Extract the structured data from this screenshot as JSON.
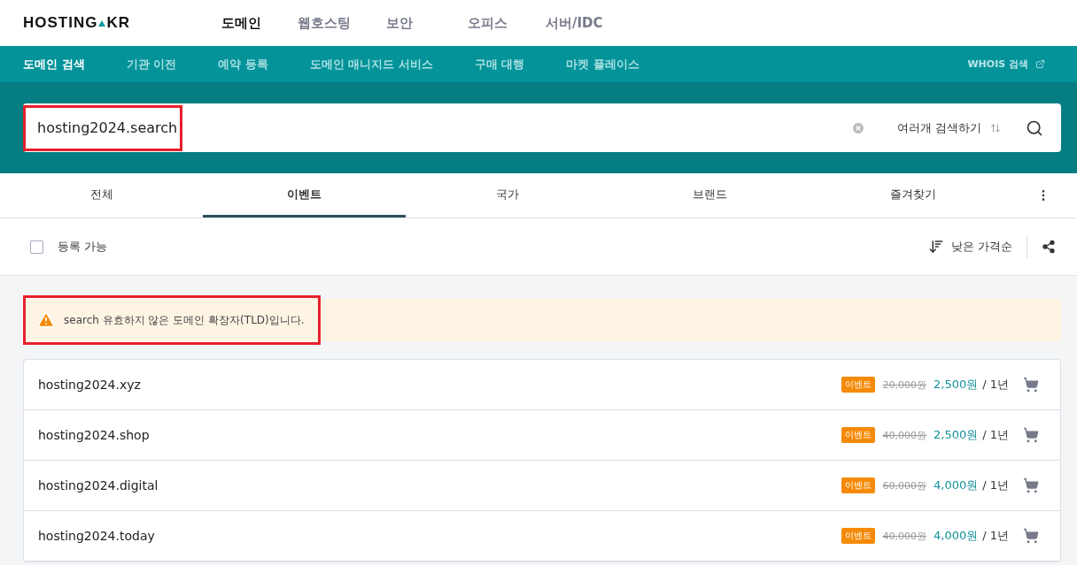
{
  "logo": {
    "text": "HOSTING",
    "suffix": "KR"
  },
  "main_nav": [
    {
      "label": "도메인",
      "selected": true
    },
    {
      "label": "웹호스팅",
      "selected": false
    },
    {
      "label": "보안",
      "selected": false
    },
    {
      "label": "오피스",
      "selected": false
    },
    {
      "label": "서버/IDC",
      "selected": false
    }
  ],
  "sub_nav": [
    {
      "label": "도메인 검색",
      "selected": true
    },
    {
      "label": "기관 이전",
      "selected": false
    },
    {
      "label": "예약 등록",
      "selected": false
    },
    {
      "label": "도메인 매니지드 서비스",
      "selected": false
    },
    {
      "label": "구매 대행",
      "selected": false
    },
    {
      "label": "마켓 플레이스",
      "selected": false
    }
  ],
  "whois_link": "WHOIS 검색",
  "search": {
    "value": "hosting2024.search",
    "highlighted": true,
    "multi_search": "여러개 검색하기"
  },
  "tabs": [
    {
      "label": "전체",
      "selected": false
    },
    {
      "label": "이벤트",
      "selected": true
    },
    {
      "label": "국가",
      "selected": false
    },
    {
      "label": "브랜드",
      "selected": false
    },
    {
      "label": "즐겨찾기",
      "selected": false
    }
  ],
  "filter": {
    "label": "등록 가능",
    "checked": false,
    "sort": "낮은 가격순"
  },
  "notice": {
    "text": "search 유효하지 않은 도메인 확장자(TLD)입니다.",
    "highlighted": true
  },
  "results": [
    {
      "domain": "hosting2024.xyz",
      "badge": "이벤트",
      "old_price": "20,000원",
      "price": "2,500원",
      "period": "/ 1년"
    },
    {
      "domain": "hosting2024.shop",
      "badge": "이벤트",
      "old_price": "40,000원",
      "price": "2,500원",
      "period": "/ 1년"
    },
    {
      "domain": "hosting2024.digital",
      "badge": "이벤트",
      "old_price": "60,000원",
      "price": "4,000원",
      "period": "/ 1년"
    },
    {
      "domain": "hosting2024.today",
      "badge": "이벤트",
      "old_price": "40,000원",
      "price": "4,000원",
      "period": "/ 1년"
    }
  ]
}
